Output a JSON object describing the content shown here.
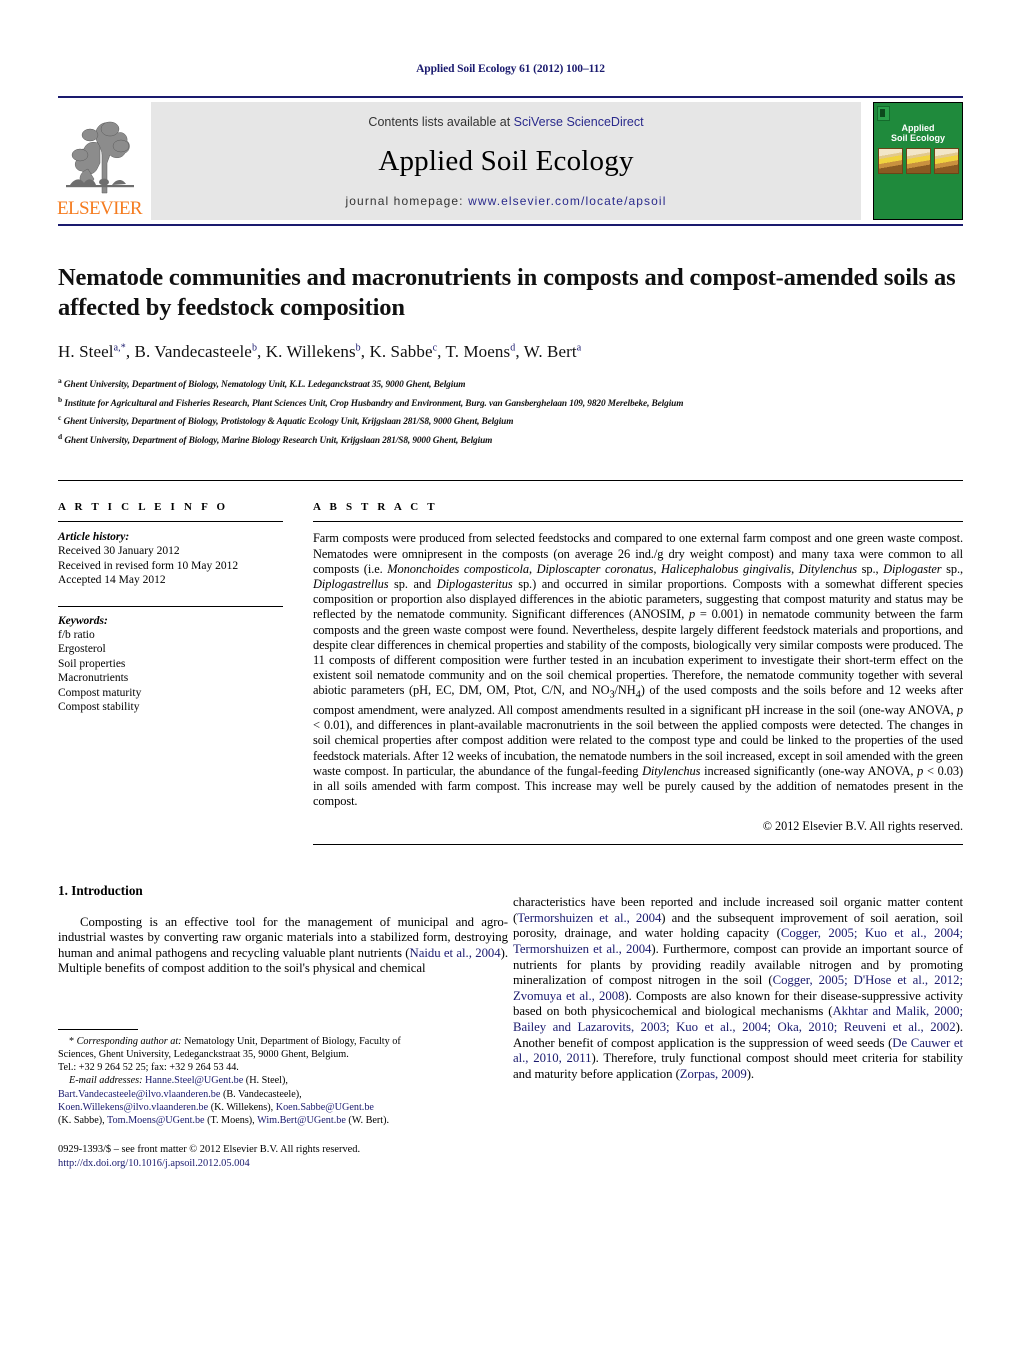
{
  "running_head": "Applied Soil Ecology 61 (2012) 100–112",
  "header": {
    "contents_prefix": "Contents lists available at ",
    "sciencedirect_link": "SciVerse ScienceDirect",
    "journal_title": "Applied Soil Ecology",
    "homepage_prefix": "journal homepage: ",
    "homepage_url": "www.elsevier.com/locate/apsoil",
    "publisher_wordmark": "ELSEVIER",
    "cover_title_line1": "Applied",
    "cover_title_line2": "Soil Ecology",
    "link_color": "#2a2a8c",
    "rule_color": "#1a1a6e",
    "band_background": "#e6e6e6",
    "cover_background": "#1f8a3c",
    "wordmark_color": "#f57c20"
  },
  "article": {
    "title": "Nematode communities and macronutrients in composts and compost-amended soils as affected by feedstock composition",
    "authors_html": "H. Steel<sup>a,*</sup>, B. Vandecasteele<sup>b</sup>, K. Willekens<sup>b</sup>, K. Sabbe<sup>c</sup>, T. Moens<sup>d</sup>, W. Bert<sup>a</sup>",
    "affiliations": [
      {
        "marker": "a",
        "text": "Ghent University, Department of Biology, Nematology Unit, K.L. Ledeganckstraat 35, 9000 Ghent, Belgium"
      },
      {
        "marker": "b",
        "text": "Institute for Agricultural and Fisheries Research, Plant Sciences Unit, Crop Husbandry and Environment, Burg. van Gansberghelaan 109, 9820 Merelbeke, Belgium"
      },
      {
        "marker": "c",
        "text": "Ghent University, Department of Biology, Protistology & Aquatic Ecology Unit, Krijgslaan 281/S8, 9000 Ghent, Belgium"
      },
      {
        "marker": "d",
        "text": "Ghent University, Department of Biology, Marine Biology Research Unit, Krijgslaan 281/S8, 9000 Ghent, Belgium"
      }
    ]
  },
  "article_info": {
    "heading": "A R T I C L E   I N F O",
    "history_label": "Article history:",
    "history": [
      "Received 30 January 2012",
      "Received in revised form 10 May 2012",
      "Accepted 14 May 2012"
    ],
    "keywords_label": "Keywords:",
    "keywords": [
      "f/b ratio",
      "Ergosterol",
      "Soil properties",
      "Macronutrients",
      "Compost maturity",
      "Compost stability"
    ]
  },
  "abstract": {
    "heading": "A B S T R A C T",
    "body_html": "Farm composts were produced from selected feedstocks and compared to one external farm compost and one green waste compost. Nematodes were omnipresent in the composts (on average 26 ind./g dry weight compost) and many taxa were common to all composts (i.e. <i>Mononchoides composticola</i>, <i>Diploscapter coronatus</i>, <i>Halicephalobus gingivalis</i>, <i>Ditylenchus</i> sp., <i>Diplogaster</i> sp., <i>Diplogastrellus</i> sp. and <i>Diplogasteritus</i> sp.) and occurred in similar proportions. Composts with a somewhat different species composition or proportion also displayed differences in the abiotic parameters, suggesting that compost maturity and status may be reflected by the nematode community. Significant differences (ANOSIM, <i>p</i> = 0.001) in nematode community between the farm composts and the green waste compost were found. Nevertheless, despite largely different feedstock materials and proportions, and despite clear differences in chemical properties and stability of the composts, biologically very similar composts were produced. The 11 composts of different composition were further tested in an incubation experiment to investigate their short-term effect on the existent soil nematode community and on the soil chemical properties. Therefore, the nematode community together with several abiotic parameters (pH, EC, DM, OM, Ptot, C/N, and NO<sub>3</sub>/NH<sub>4</sub>) of the used composts and the soils before and 12 weeks after compost amendment, were analyzed. All compost amendments resulted in a significant pH increase in the soil (one-way ANOVA, <i>p</i> &lt; 0.01), and differences in plant-available macronutrients in the soil between the applied composts were detected. The changes in soil chemical properties after compost addition were related to the compost type and could be linked to the properties of the used feedstock materials. After 12 weeks of incubation, the nematode numbers in the soil increased, except in soil amended with the green waste compost. In particular, the abundance of the fungal-feeding <i>Ditylenchus</i> increased significantly (one-way ANOVA, <i>p</i> &lt; 0.03) in all soils amended with farm compost. This increase may well be purely caused by the addition of nematodes present in the compost.",
    "copyright": "© 2012 Elsevier B.V. All rights reserved."
  },
  "introduction": {
    "heading": "1.  Introduction",
    "left_para_html": "Composting is an effective tool for the management of municipal and agro-industrial wastes by converting raw organic materials into a stabilized form, destroying human and animal pathogens and recycling valuable plant nutrients (<span class=\"ref\">Naidu et al., 2004</span>). Multiple benefits of compost addition to the soil's physical and chemical",
    "right_para_html": "characteristics have been reported and include increased soil organic matter content (<span class=\"ref\">Termorshuizen et al., 2004</span>) and the subsequent improvement of soil aeration, soil porosity, drainage, and water holding capacity (<span class=\"ref\">Cogger, 2005; Kuo et al., 2004; Termorshuizen et al., 2004</span>). Furthermore, compost can provide an important source of nutrients for plants by providing readily available nitrogen and by promoting mineralization of compost nitrogen in the soil (<span class=\"ref\">Cogger, 2005; D'Hose et al., 2012; Zvomuya et al., 2008</span>). Composts are also known for their disease-suppressive activity based on both physicochemical and biological mechanisms (<span class=\"ref\">Akhtar and Malik, 2000; Bailey and Lazarovits, 2003; Kuo et al., 2004; Oka, 2010; Reuveni et al., 2002</span>). Another benefit of compost application is the suppression of weed seeds (<span class=\"ref\">De Cauwer et al., 2010, 2011</span>). Therefore, truly functional compost should meet criteria for stability and maturity before application (<span class=\"ref\">Zorpas, 2009</span>)."
  },
  "footnote": {
    "corresponding_html": "<span class=\"fn-indent\">* <i>Corresponding author at:</i> Nematology Unit, Department of Biology, Faculty of</span>Sciences, Ghent University, Ledeganckstraat 35, 9000 Ghent, Belgium.<br>Tel.: +32 9 264 52 25; fax: +32 9 264 53 44.",
    "email_html": "<span class=\"fn-indent\"><i>E-mail addresses:</i> <span class=\"mail\">Hanne.Steel@UGent.be</span> (H. Steel),</span><span class=\"mail\">Bart.Vandecasteele@ilvo.vlaanderen.be</span> (B. Vandecasteele),<br><span class=\"mail\">Koen.Willekens@ilvo.vlaanderen.be</span> (K. Willekens), <span class=\"mail\">Koen.Sabbe@UGent.be</span><br>(K. Sabbe), <span class=\"mail\">Tom.Moens@UGent.be</span> (T. Moens), <span class=\"mail\">Wim.Bert@UGent.be</span> (W. Bert).",
    "issn_line": "0929-1393/$ – see front matter © 2012 Elsevier B.V. All rights reserved.",
    "doi_line": "http://dx.doi.org/10.1016/j.apsoil.2012.05.004"
  }
}
